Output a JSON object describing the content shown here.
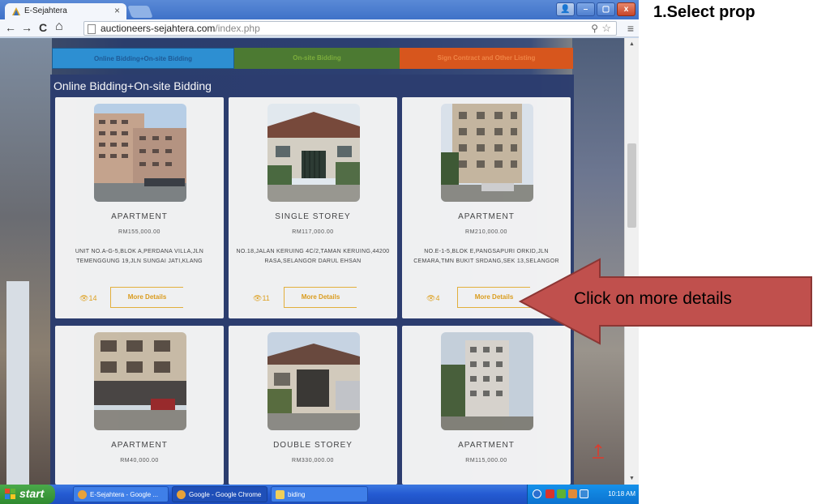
{
  "browser": {
    "tab_title": "E-Sejahtera",
    "tab_close": "×",
    "url_host": "auctioneers-sejahtera.com",
    "url_path": "/index.php",
    "window_user_glyph": "👤",
    "window_min": "–",
    "window_max": "▢",
    "window_close": "x",
    "nav_back": "←",
    "nav_forward": "→",
    "nav_reload": "C",
    "nav_home": "⌂",
    "menu_glyph": "≡",
    "zoom_glyph": "⚲",
    "star_glyph": "☆"
  },
  "site": {
    "tabs": [
      {
        "label": "Online Bidding+On-site Bidding"
      },
      {
        "label": "On-site Bidding"
      },
      {
        "label": "Sign Contract and Other Listing"
      }
    ],
    "section_title": "Online Bidding+On-site Bidding",
    "more_details_label": "More Details",
    "cards": [
      {
        "type": "APARTMENT",
        "price": "RM155,000.00",
        "address": "UNIT NO.A-G-5,BLOK A,PERDANA VILLA,JLN TEMENGGUNG 19,JLN SUNGAI JATI,KLANG",
        "views": "14"
      },
      {
        "type": "SINGLE STOREY",
        "price": "RM117,000.00",
        "address": "NO.18,JALAN KERUING 4C/2,TAMAN KERUING,44200 RASA,SELANGOR DARUL EHSAN",
        "views": "11"
      },
      {
        "type": "APARTMENT",
        "price": "RM210,000.00",
        "address": "NO.E-1-5,BLOK E,PANGSAPURI ORKID,JLN CEMARA,TMN BUKIT SRDANG,SEK 13,SELANGOR",
        "views": "4"
      },
      {
        "type": "APARTMENT",
        "price": "RM40,000.00"
      },
      {
        "type": "DOUBLE STOREY",
        "price": "RM330,000.00"
      },
      {
        "type": "APARTMENT",
        "price": "RM115,000.00"
      }
    ]
  },
  "taskbar": {
    "start_label": "start",
    "items": [
      {
        "label": "E-Sejahtera - Google ..."
      },
      {
        "label": "Google - Google Chrome"
      },
      {
        "label": "biding"
      }
    ],
    "clock": "10:18 AM"
  },
  "annotation": {
    "heading": "1.Select prop",
    "callout": "Click on more details"
  },
  "colors": {
    "tab_online": "#2d8fd2",
    "tab_onsite": "#4c7a32",
    "tab_contract": "#d7561d",
    "accent_gold": "#e8b33b",
    "callout_red": "#c0504d"
  }
}
